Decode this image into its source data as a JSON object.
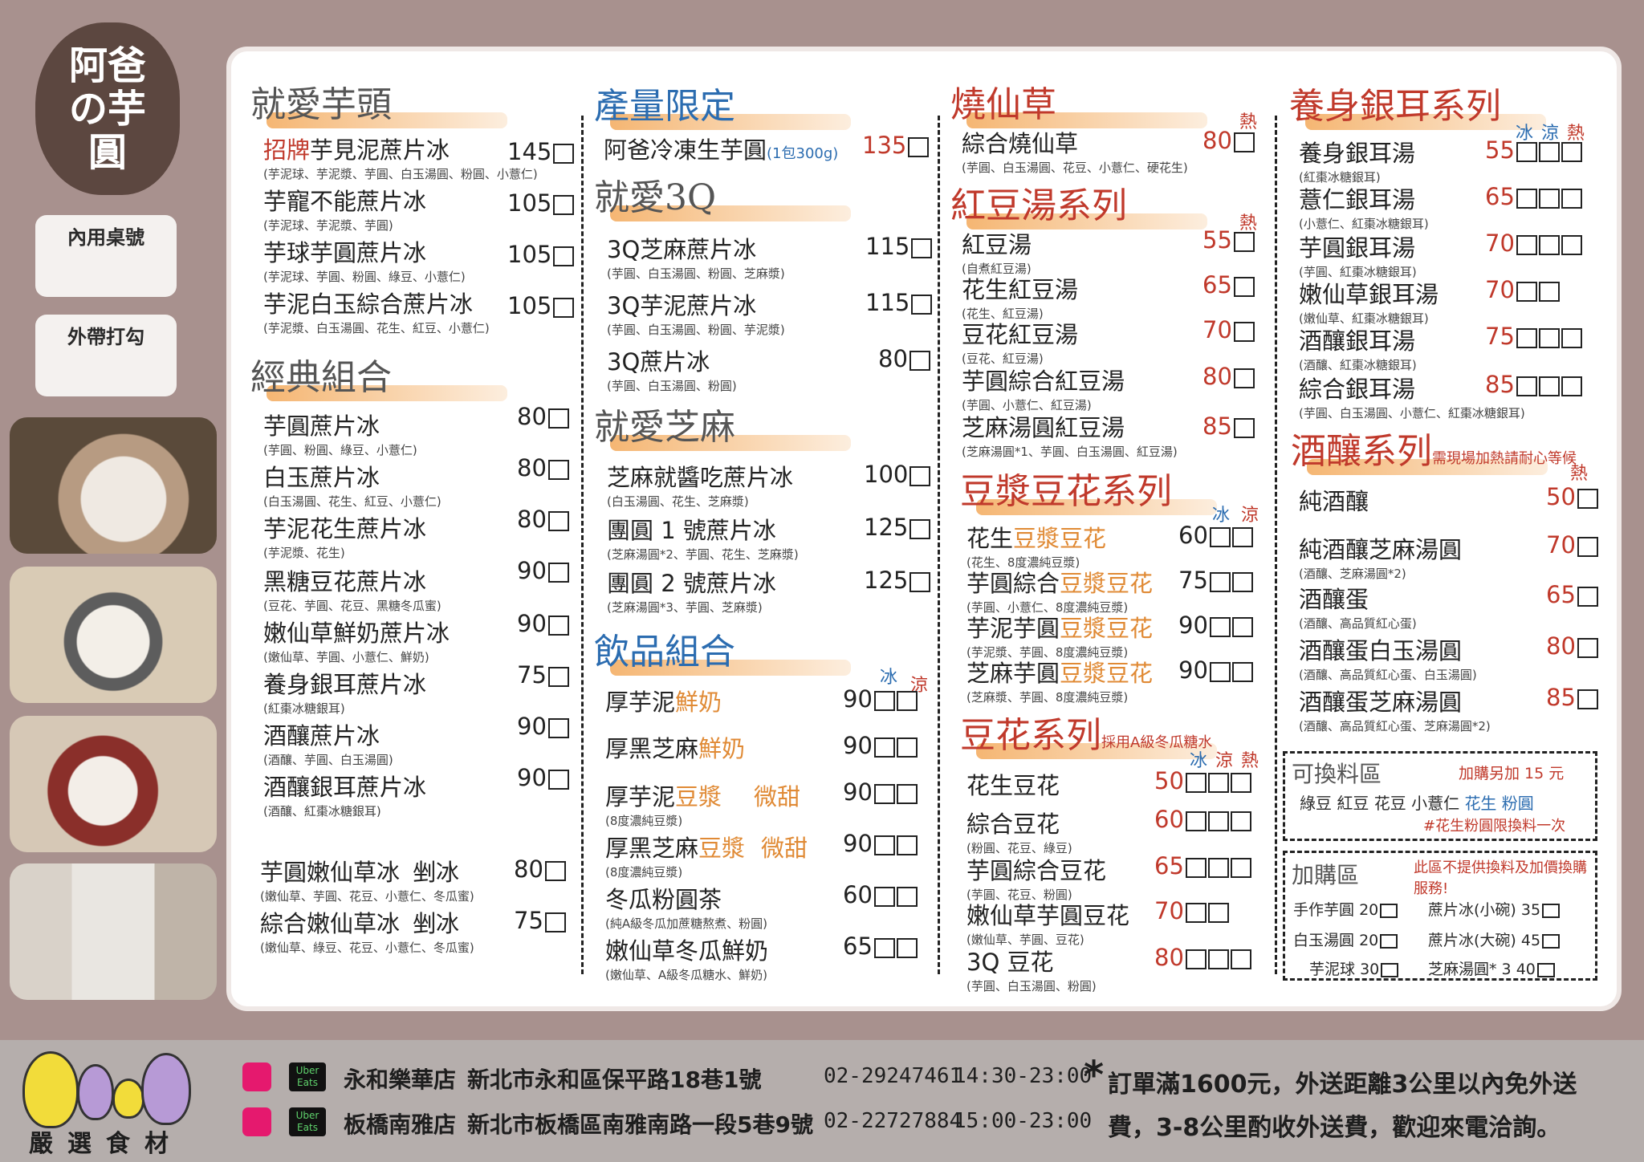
{
  "brand": {
    "logo": "阿爸の芋圓",
    "table_no": "內用桌號",
    "takeout": "外帶打勾",
    "select": "嚴選食材"
  },
  "col1": {
    "h1": "就愛芋頭",
    "items1": [
      {
        "name_red": "招牌",
        "name": "芋見泥蔗片冰",
        "price": "145",
        "sub": "(芋泥球、芋泥漿、芋圓、白玉湯圓、粉圓、小薏仁)"
      },
      {
        "name": "芋寵不能蔗片冰",
        "price": "105",
        "sub": "(芋泥球、芋泥漿、芋圓)"
      },
      {
        "name": "芋球芋圓蔗片冰",
        "price": "105",
        "sub": "(芋泥球、芋圓、粉圓、綠豆、小薏仁)"
      },
      {
        "name": "芋泥白玉綜合蔗片冰",
        "price": "105",
        "sub": "(芋泥漿、白玉湯圓、花生、紅豆、小薏仁)"
      }
    ],
    "h2": "經典組合",
    "items2": [
      {
        "name": "芋圓蔗片冰",
        "price": "80",
        "sub": "(芋圓、粉圓、綠豆、小薏仁)"
      },
      {
        "name": "白玉蔗片冰",
        "price": "80",
        "sub": "(白玉湯圓、花生、紅豆、小薏仁)"
      },
      {
        "name": "芋泥花生蔗片冰",
        "price": "80",
        "sub": "(芋泥漿、花生)"
      },
      {
        "name": "黑糖豆花蔗片冰",
        "price": "90",
        "sub": "(豆花、芋圓、花豆、黑糖冬瓜蜜)"
      },
      {
        "name": "嫩仙草鮮奶蔗片冰",
        "price": "90",
        "sub": "(嫩仙草、芋圓、小薏仁、鮮奶)"
      },
      {
        "name": "養身銀耳蔗片冰",
        "price": "75",
        "sub": "(紅棗冰糖銀耳)"
      },
      {
        "name": "酒釀蔗片冰",
        "price": "90",
        "sub": "(酒釀、芋圓、白玉湯圓)"
      },
      {
        "name": "酒釀銀耳蔗片冰",
        "price": "90",
        "sub": "(酒釀、紅棗冰糖銀耳)"
      }
    ],
    "items3": [
      {
        "name": "芋圓嫩仙草冰",
        "tag": "剉冰",
        "price": "80",
        "sub": "(嫩仙草、芋圓、花豆、小薏仁、冬瓜蜜)"
      },
      {
        "name": "綜合嫩仙草冰",
        "tag": "剉冰",
        "price": "75",
        "sub": "(嫩仙草、綠豆、花豆、小薏仁、冬瓜蜜)"
      }
    ]
  },
  "col2": {
    "h1": "產量限定",
    "frozen": {
      "name": "阿爸冷凍生芋圓",
      "note": "(1包300g)",
      "price": "135"
    },
    "h2": "就愛3Q",
    "items1": [
      {
        "name": "3Q芝麻蔗片冰",
        "price": "115",
        "sub": "(芋圓、白玉湯圓、粉圓、芝麻漿)"
      },
      {
        "name": "3Q芋泥蔗片冰",
        "price": "115",
        "sub": "(芋圓、白玉湯圓、粉圓、芋泥漿)"
      },
      {
        "name": "3Q蔗片冰",
        "price": "80",
        "sub": "(芋圓、白玉湯圓、粉圓)"
      }
    ],
    "h3": "就愛芝麻",
    "items2": [
      {
        "name": "芝麻就醬吃蔗片冰",
        "price": "100",
        "sub": "(白玉湯圓、花生、芝麻漿)"
      },
      {
        "name": "團圓 1 號蔗片冰",
        "price": "125",
        "sub": "(芝麻湯圓*2、芋圓、花生、芝麻漿)"
      },
      {
        "name": "團圓 2 號蔗片冰",
        "price": "125",
        "sub": "(芝麻湯圓*3、芋圓、芝麻漿)"
      }
    ],
    "h4": "飲品組合",
    "ice": "冰",
    "cool": "涼",
    "drinks": [
      {
        "a": "厚芋泥",
        "b": "鮮奶",
        "c": "",
        "price": "90",
        "sub": ""
      },
      {
        "a": "厚黑芝麻",
        "b": "鮮奶",
        "c": "",
        "price": "90",
        "sub": ""
      },
      {
        "a": "厚芋泥",
        "b": "豆漿",
        "c": "微甜",
        "price": "90",
        "sub": "(8度濃純豆漿)"
      },
      {
        "a": "厚黑芝麻",
        "b": "豆漿",
        "c": "微甜",
        "price": "90",
        "sub": "(8度濃純豆漿)"
      },
      {
        "a": "冬瓜粉圓茶",
        "b": "",
        "c": "",
        "price": "60",
        "sub": "(純A級冬瓜加蔗糖熬煮、粉圓)"
      },
      {
        "a": "嫩仙草冬瓜鮮奶",
        "b": "",
        "c": "",
        "price": "65",
        "sub": "(嫩仙草、A級冬瓜糖水、鮮奶)"
      }
    ]
  },
  "col3": {
    "h1": "燒仙草",
    "hot": "熱",
    "sxc": {
      "name": "綜合燒仙草",
      "price": "80",
      "sub": "(芋圓、白玉湯圓、花豆、小薏仁、硬花生)"
    },
    "h2": "紅豆湯系列",
    "redbean": [
      {
        "name": "紅豆湯",
        "price": "55",
        "sub": "(自煮紅豆湯)"
      },
      {
        "name": "花生紅豆湯",
        "price": "65",
        "sub": "(花生、紅豆湯)"
      },
      {
        "name": "豆花紅豆湯",
        "price": "70",
        "sub": "(豆花、紅豆湯)"
      },
      {
        "name": "芋圓綜合紅豆湯",
        "price": "80",
        "sub": "(芋圓、小薏仁、紅豆湯)"
      },
      {
        "name": "芝麻湯圓紅豆湯",
        "price": "85",
        "sub": "(芝麻湯圓*1、芋圓、白玉湯圓、紅豆湯)"
      }
    ],
    "h3": "豆漿豆花系列",
    "ice": "冰",
    "cool": "涼",
    "soy": [
      {
        "a": "花生",
        "b": "豆漿豆花",
        "price": "60",
        "sub": "(花生、8度濃純豆漿)"
      },
      {
        "a": "芋圓綜合",
        "b": "豆漿豆花",
        "price": "75",
        "sub": "(芋圓、小薏仁、8度濃純豆漿)"
      },
      {
        "a": "芋泥芋圓",
        "b": "豆漿豆花",
        "price": "90",
        "sub": "(芋泥漿、芋圓、8度濃純豆漿)"
      },
      {
        "a": "芝麻芋圓",
        "b": "豆漿豆花",
        "price": "90",
        "sub": "(芝麻漿、芋圓、8度濃純豆漿)"
      }
    ],
    "h4": "豆花系列",
    "h4note": "採用A級冬瓜糖水",
    "tofu": [
      {
        "name": "花生豆花",
        "price": "50",
        "sub": ""
      },
      {
        "name": "綜合豆花",
        "price": "60",
        "sub": "(粉圓、花豆、綠豆)"
      },
      {
        "name": "芋圓綜合豆花",
        "price": "65",
        "sub": "(芋圓、花豆、粉圓)"
      },
      {
        "name": "嫩仙草芋圓豆花",
        "price": "70",
        "sub": "(嫩仙草、芋圓、豆花)"
      },
      {
        "name": "3Q 豆花",
        "price": "80",
        "sub": "(芋圓、白玉湯圓、粉圓)"
      }
    ]
  },
  "col4": {
    "h1": "養身銀耳系列",
    "ice": "冰",
    "cool": "涼",
    "hot": "熱",
    "silver": [
      {
        "name": "養身銀耳湯",
        "price": "55",
        "sub": "(紅棗冰糖銀耳)"
      },
      {
        "name": "薏仁銀耳湯",
        "price": "65",
        "sub": "(小薏仁、紅棗冰糖銀耳)"
      },
      {
        "name": "芋圓銀耳湯",
        "price": "70",
        "sub": "(芋圓、紅棗冰糖銀耳)"
      },
      {
        "name": "嫩仙草銀耳湯",
        "price": "70",
        "sub": "(嫩仙草、紅棗冰糖銀耳)"
      },
      {
        "name": "酒釀銀耳湯",
        "price": "75",
        "sub": "(酒釀、紅棗冰糖銀耳)"
      },
      {
        "name": "綜合銀耳湯",
        "price": "85",
        "sub": "(芋圓、白玉湯圓、小薏仁、紅棗冰糖銀耳)"
      }
    ],
    "h2": "酒釀系列",
    "h2note": "需現場加熱請耐心等候",
    "wine": [
      {
        "name": "純酒釀",
        "price": "50",
        "sub": ""
      },
      {
        "name": "純酒釀芝麻湯圓",
        "price": "70",
        "sub": "(酒釀、芝麻湯圓*2)"
      },
      {
        "name": "酒釀蛋",
        "price": "65",
        "sub": "(酒釀、高品質紅心蛋)"
      },
      {
        "name": "酒釀蛋白玉湯圓",
        "price": "80",
        "sub": "(酒釀、高品質紅心蛋、白玉湯圓)"
      },
      {
        "name": "酒釀蛋芝麻湯圓",
        "price": "85",
        "sub": "(酒釀、高品質紅心蛋、芝麻湯圓*2)"
      }
    ],
    "swap": {
      "title": "可換料區",
      "note": "加購另加 15 元",
      "items": "綠豆 紅豆 花豆 小薏仁",
      "blue": "花生 粉圓",
      "rule": "#花生粉圓限換料一次"
    },
    "addon": {
      "title": "加購區",
      "note": "此區不提供換料及加價換購服務!",
      "rows": [
        {
          "a": "手作芋圓",
          "ap": "20",
          "b": "蔗片冰(小碗)",
          "bp": "35"
        },
        {
          "a": "白玉湯圓",
          "ap": "20",
          "b": "蔗片冰(大碗)",
          "bp": "45"
        },
        {
          "a": "芋泥球",
          "ap": "30",
          "b": "芝麻湯圓* 3",
          "bp": "40"
        }
      ]
    }
  },
  "footer": {
    "uber": "Uber Eats",
    "stores": [
      {
        "name": "永和樂華店",
        "addr": "新北市永和區保平路18巷1號",
        "tel": "02-29247461",
        "hours": "14:30-23:00"
      },
      {
        "name": "板橋南雅店",
        "addr": "新北市板橋區南雅南路一段5巷9號",
        "tel": "02-22727884",
        "hours": "15:00-23:00"
      }
    ],
    "star": "*",
    "note1": "訂單滿1600元，外送距離3公里以內免外送",
    "note2": "費，3-8公里酌收外送費，歡迎來電洽詢。"
  }
}
